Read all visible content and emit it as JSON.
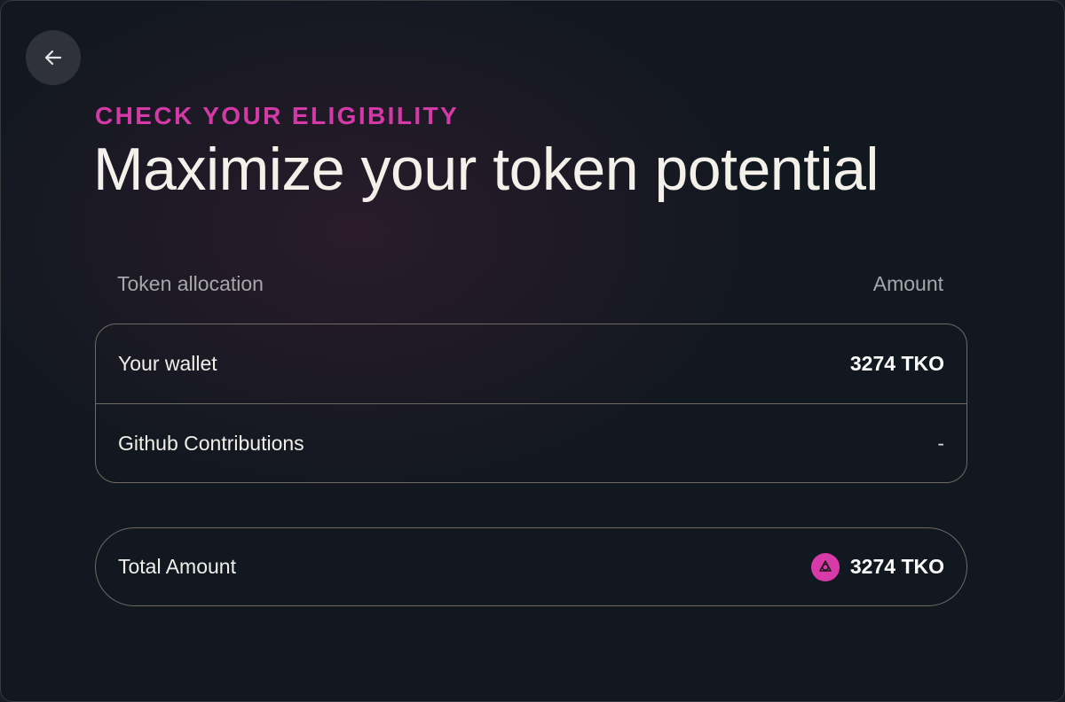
{
  "header": {
    "eyebrow": "CHECK YOUR ELIGIBILITY",
    "title": "Maximize your token potential"
  },
  "table": {
    "columns": [
      "Token allocation",
      "Amount"
    ],
    "rows": [
      {
        "label": "Your wallet",
        "amount": "3274 TKO"
      },
      {
        "label": "Github Contributions",
        "amount": "-"
      }
    ]
  },
  "total": {
    "label": "Total Amount",
    "amount": "3274 TKO",
    "icon": "token-logo-icon"
  },
  "colors": {
    "accent": "#d33aa8",
    "background": "#121820",
    "border": "#6f6a62"
  }
}
